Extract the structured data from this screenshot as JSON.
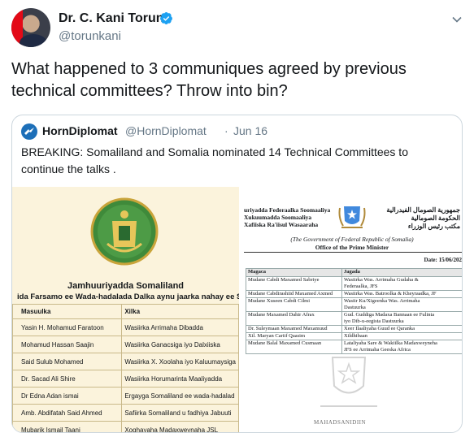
{
  "author": {
    "display_name": "Dr. C. Kani Torun",
    "handle": "@torunkani",
    "verified_icon": "verified-badge-icon"
  },
  "tweet": {
    "text": "What happened to  3 communiques agreed by previous technical committees? Throw into bin?"
  },
  "quoted": {
    "display_name": "HornDiplomat",
    "handle": "@HornDiplomat",
    "separator": "·",
    "date": "Jun 16",
    "text": "BREAKING: Somaliland and Somalia nominated 14 Technical Committees to continue the talks ."
  },
  "doc_left": {
    "title": "Jamhuuriyadda Somaliland",
    "subtitle": "ida Farsamo ee Wada-hadalada Dalka aynu jaarka nahay ee Sc",
    "headers": [
      "Masuulka",
      "Xilka"
    ],
    "rows": [
      [
        "Yasin H. Mohamud Faratoon",
        "Wasiirka Arrimaha Dibadda"
      ],
      [
        "Mohamud Hassan Saajin",
        "Wasiirka Ganacsiga iyo Dalxiiska"
      ],
      [
        "Said Sulub Mohamed",
        "Wasiirka X. Xoolaha iyo Kaluumaysiga"
      ],
      [
        "Dr. Sacad Ali Shire",
        "Wasiirka Horumarinta Maaliyadda"
      ],
      [
        "Dr Edna Adan ismai",
        "Ergayga Somaliland ee wada-hadalad"
      ],
      [
        "Amb. Abdifatah Said Ahmed",
        "Safiirka Somaliland u fadhiya Jabuuti"
      ],
      [
        "Mubarik Ismail Taani",
        "Xoghayaha Madaxweynaha JSL"
      ]
    ]
  },
  "doc_right": {
    "header_left": [
      "uriyadda Federaalka Soomaaliya",
      "Xukuumadda Soomaaliya",
      "Xafiiska Ra'iisul Wasaaraha"
    ],
    "header_arabic": [
      "جمهورية الصومال الفيدرالية",
      "الحكومة الصومالية",
      "مكتب رئيس الوزراء"
    ],
    "gov_line": "(The Government of Federal Republic of Somalia)",
    "office_line": "Office of the Prime Minister",
    "date": "Date: 15/06/202",
    "headers": [
      "Magaca",
      "Jagada"
    ],
    "rows": [
      [
        "Mudane Cabdi Maxamed Sabriye",
        "Wasiirka Was. Arrimaha Gudaha &",
        "Federaalka, JFS"
      ],
      [
        "Mudane Cabdirashiid Maxamed Axmed",
        "Wasiirka Was. Batroolka & Kheyraadka, JF",
        ""
      ],
      [
        "Mudane Xuseen Cabdi Cilmi",
        "Wasiir Ku/Xigeenka Was. Arrimaha",
        "Dastuurka"
      ],
      [
        "Mudane Maxamed Dahir Afrax",
        "Gud. Guddiga Madaxa Bannaan ee Fulinta",
        "iyo Dib-u-eegista Dastuurka"
      ],
      [
        "Dr. Suleymaan Maxamed Maxamuud",
        "Xeer Ilaaliyaha Guud ee Qaranka",
        ""
      ],
      [
        "Xil. Maryan Cariif Qaasim",
        "Xildhibaan",
        ""
      ],
      [
        "Mudane Balal Maxamed Cusmaan",
        "Lataliyaha Sare & Wakiilka Madaxweyneha",
        "JFS ee Arrimaha Geeska Africa"
      ]
    ],
    "footer": "MAHADSANIDIIN"
  },
  "colors": {
    "text_primary": "#14171a",
    "text_secondary": "#657786",
    "border": "#ccd6dd",
    "verified_blue": "#1da1f2"
  }
}
